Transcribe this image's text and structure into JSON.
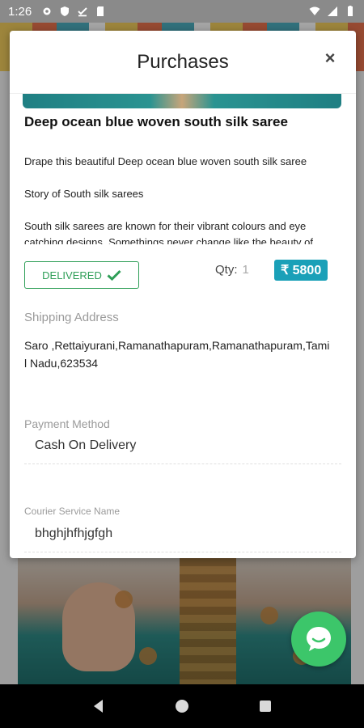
{
  "status_bar": {
    "time": "1:26"
  },
  "modal": {
    "title": "Purchases",
    "close_label": "×"
  },
  "product": {
    "title": "Deep ocean blue woven south silk saree",
    "description": [
      "Drape this beautiful Deep ocean blue woven south silk saree",
      "Story of South silk sarees",
      "South silk sarees are known for their vibrant colours and eye catching designs. Somethings never change like the beauty of"
    ],
    "status": "DELIVERED",
    "qty_label": "Qty:",
    "qty_value": "1",
    "price": "₹ 5800"
  },
  "shipping": {
    "label": "Shipping Address",
    "address": "Saro ,Rettaiyurani,Ramanathapuram,Ramanathapuram,Tamil Nadu,623534"
  },
  "payment": {
    "label": "Payment Method",
    "value": "Cash On Delivery"
  },
  "courier": {
    "label": "Courier Service Name",
    "value": "bhghjhfhjgfgh"
  },
  "colors": {
    "delivered_green": "#2e9e57",
    "price_teal": "#1aa0b8",
    "chat_green": "#3cc66a"
  }
}
